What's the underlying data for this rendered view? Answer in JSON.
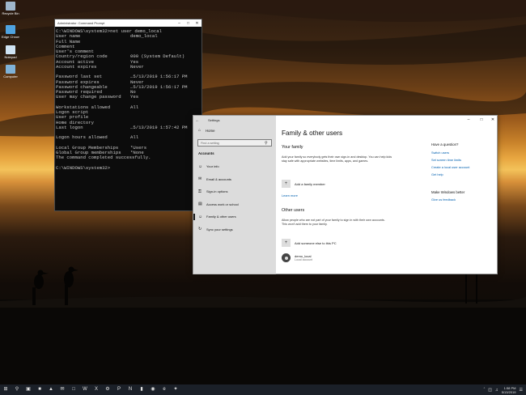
{
  "desktop": {
    "icons": [
      {
        "label": "Recycle Bin",
        "icon": "recycle-bin-icon",
        "color": "#9fb6cc"
      },
      {
        "label": "Edge Chrome",
        "icon": "browser-icon",
        "color": "#4fa3e0"
      },
      {
        "label": "Notepad",
        "icon": "notepad-icon",
        "color": "#cfe3f3"
      },
      {
        "label": "Computer",
        "icon": "computer-icon",
        "color": "#7fb2d8"
      }
    ]
  },
  "cmd": {
    "title": "Administrator: Command Prompt",
    "command": "C:\\WINDOWS\\system32>net user demo_local",
    "rows": [
      {
        "k": "User name",
        "v": "demo_local"
      },
      {
        "k": "Full Name",
        "v": ""
      },
      {
        "k": "Comment",
        "v": ""
      },
      {
        "k": "User's comment",
        "v": ""
      },
      {
        "k": "Country/region code",
        "v": "000 (System Default)"
      },
      {
        "k": "Account active",
        "v": "Yes"
      },
      {
        "k": "Account expires",
        "v": "Never"
      },
      {
        "k": "",
        "v": ""
      },
      {
        "k": "Password last set",
        "v": "…5/13/2019 1:56:17 PM"
      },
      {
        "k": "Password expires",
        "v": "Never"
      },
      {
        "k": "Password changeable",
        "v": "…5/13/2019 1:56:17 PM"
      },
      {
        "k": "Password required",
        "v": "No"
      },
      {
        "k": "User may change password",
        "v": "Yes"
      },
      {
        "k": "",
        "v": ""
      },
      {
        "k": "Workstations allowed",
        "v": "All"
      },
      {
        "k": "Logon script",
        "v": ""
      },
      {
        "k": "User profile",
        "v": ""
      },
      {
        "k": "Home directory",
        "v": ""
      },
      {
        "k": "Last logon",
        "v": "…5/13/2019 1:57:42 PM"
      },
      {
        "k": "",
        "v": ""
      },
      {
        "k": "Logon hours allowed",
        "v": "All"
      },
      {
        "k": "",
        "v": ""
      },
      {
        "k": "Local Group Memberships",
        "v": "*Users"
      },
      {
        "k": "Global Group memberships",
        "v": "*None"
      },
      {
        "k": "The command completed successfully.",
        "v": ""
      },
      {
        "k": "",
        "v": ""
      },
      {
        "k": "C:\\WINDOWS\\system32>",
        "v": ""
      }
    ]
  },
  "settings": {
    "title": "Settings",
    "sidebar": {
      "home": "Home",
      "search_placeholder": "Find a setting",
      "section": "Accounts",
      "items": [
        {
          "label": "Your info",
          "icon": "person-icon",
          "selected": false
        },
        {
          "label": "Email & accounts",
          "icon": "email-icon",
          "selected": false
        },
        {
          "label": "Sign-in options",
          "icon": "key-icon",
          "selected": false
        },
        {
          "label": "Access work or school",
          "icon": "briefcase-icon",
          "selected": false
        },
        {
          "label": "Family & other users",
          "icon": "people-icon",
          "selected": true
        },
        {
          "label": "Sync your settings",
          "icon": "sync-icon",
          "selected": false
        }
      ]
    },
    "main": {
      "title": "Family & other users",
      "family": {
        "heading": "Your family",
        "description": "Add your family so everybody gets their own sign-in and desktop. You can help kids stay safe with appropriate websites, time limits, apps, and games.",
        "add_label": "Add a family member",
        "learn_more": "Learn more"
      },
      "others": {
        "heading": "Other users",
        "description": "Allow people who are not part of your family to sign in with their own accounts. This won't add them to your family.",
        "add_label": "Add someone else to this PC",
        "user_name": "demo_local",
        "user_type": "Local account"
      }
    },
    "aside": {
      "question": "Have a question?",
      "links": [
        "Switch users",
        "Set screen time limits",
        "Create a local user account",
        "Get help"
      ],
      "better_heading": "Make Windows better",
      "feedback": "Give us feedback"
    }
  },
  "taskbar": {
    "icons": [
      "windows-icon",
      "search-icon",
      "task-view-icon",
      "file-explorer-icon",
      "store-icon",
      "mail-icon",
      "settings-icon",
      "word-icon",
      "excel-icon",
      "powerpoint-icon",
      "chrome-icon",
      "cmd-icon",
      "photos-icon"
    ],
    "tray_icons": [
      "chevron-up-icon",
      "network-icon",
      "volume-icon"
    ],
    "time": "1:58 PM",
    "date": "5/13/2019"
  }
}
